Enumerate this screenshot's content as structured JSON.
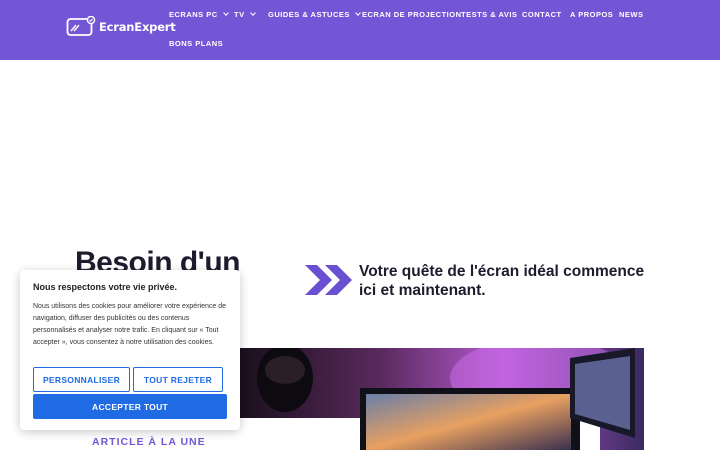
{
  "header": {
    "logo_text": "EcranExpert",
    "nav": [
      {
        "label": "ECRANS PC",
        "dropdown": true
      },
      {
        "label": "TV",
        "dropdown": true
      },
      {
        "label": "GUIDES & ASTUCES",
        "dropdown": true
      },
      {
        "label": "ECRAN DE PROJECTION",
        "dropdown": false
      },
      {
        "label": "TESTS & AVIS",
        "dropdown": false
      },
      {
        "label": "CONTACT",
        "dropdown": false
      },
      {
        "label": "A PROPOS",
        "dropdown": false
      },
      {
        "label": "NEWS",
        "dropdown": false
      },
      {
        "label": "BONS PLANS",
        "dropdown": false
      }
    ],
    "color": "#7256d6"
  },
  "hero": {
    "heading": "Besoin d'un",
    "tagline": "Votre quête de l'écran idéal commence ici et maintenant.",
    "chevron_color": "#6a4fd0"
  },
  "featured": {
    "label": "ARTICLE À LA UNE"
  },
  "cookie_banner": {
    "title": "Nous respectons votre vie privée.",
    "text": "Nous utilisons des cookies pour améliorer votre expérience de navigation, diffuser des publicités ou des contenus personnalisés et analyser notre trafic. En cliquant sur « Tout accepter », vous consentez à notre utilisation des cookies.",
    "customize_label": "PERSONNALISER",
    "reject_label": "TOUT REJETER",
    "accept_label": "ACCEPTER TOUT",
    "button_color": "#1e6be3"
  }
}
